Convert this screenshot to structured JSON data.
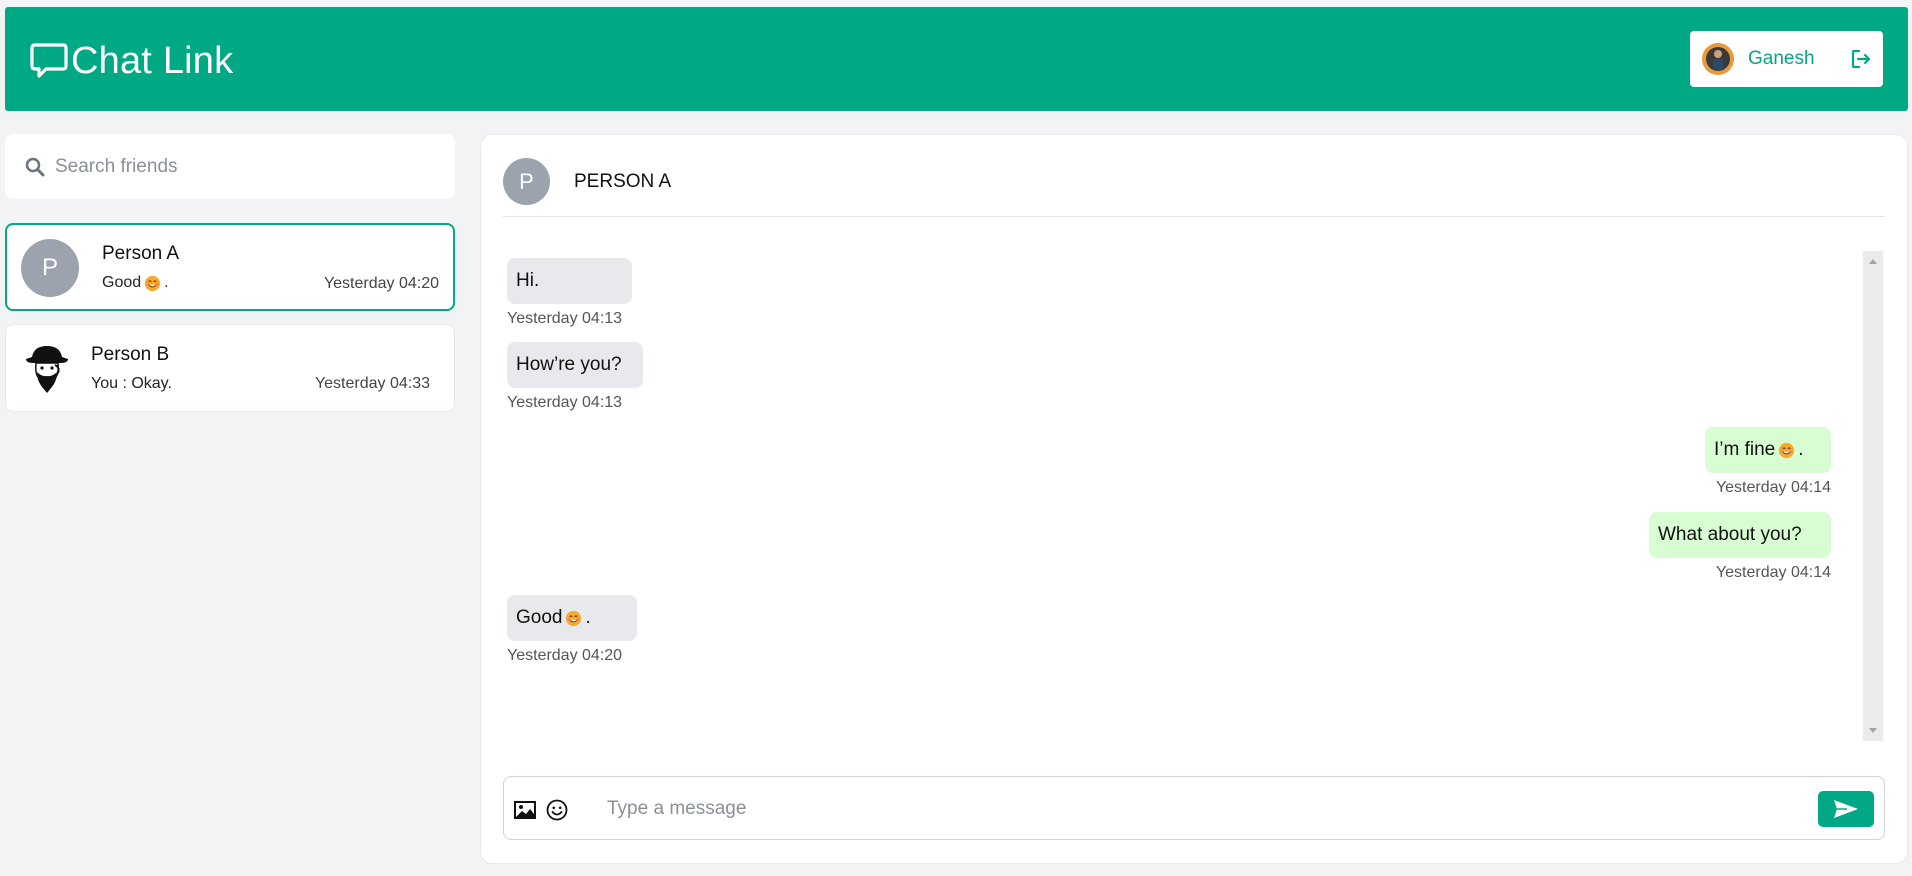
{
  "app": {
    "title": "Chat Link",
    "accent": "#00a884",
    "user": {
      "name": "Ganesh",
      "avatar_icon": "user-avatar-photo"
    }
  },
  "sidebar": {
    "search": {
      "placeholder": "Search friends",
      "value": ""
    },
    "friends": [
      {
        "name": "Person A",
        "avatar_letter": "P",
        "last_message": "Good",
        "last_message_suffix": ".",
        "has_emoji": true,
        "time": "Yesterday 04:20",
        "active": true
      },
      {
        "name": "Person B",
        "avatar_icon": "bearded-man-hat-avatar",
        "last_message": "You : Okay.",
        "time": "Yesterday 04:33",
        "active": false
      }
    ]
  },
  "chat": {
    "header": {
      "avatar_letter": "P",
      "name": "PERSON A"
    },
    "messages": [
      {
        "text": "Hi.",
        "time": "Yesterday 04:13",
        "direction": "incoming"
      },
      {
        "text": "How’re you?",
        "time": "Yesterday 04:13",
        "direction": "incoming"
      },
      {
        "text": "I’m fine",
        "suffix": ".",
        "has_emoji": true,
        "time": "Yesterday 04:14",
        "direction": "outgoing"
      },
      {
        "text": "What about you?",
        "time": "Yesterday 04:14",
        "direction": "outgoing"
      },
      {
        "text": "Good",
        "suffix": ".",
        "has_emoji": true,
        "time": "Yesterday 04:20",
        "direction": "incoming"
      }
    ],
    "composer": {
      "placeholder": "Type a message",
      "value": ""
    }
  }
}
